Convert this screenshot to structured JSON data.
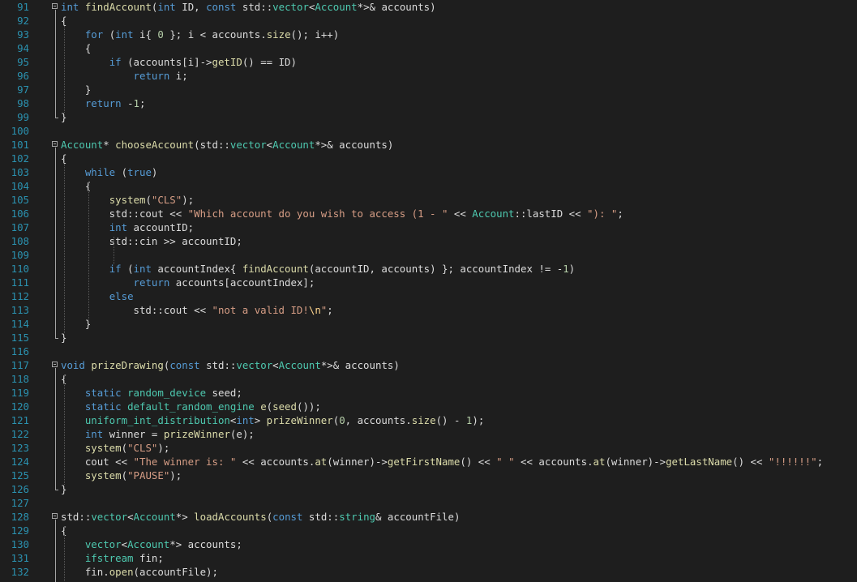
{
  "editor": {
    "colors": {
      "background": "#1e1e1e",
      "line_number": "#2b91af",
      "keyword": "#569cd6",
      "type": "#4ec9b0",
      "function": "#dcdcaa",
      "string": "#d69d85",
      "number": "#b5cea8",
      "plain": "#dcdcdc"
    },
    "lines": [
      {
        "n": "91",
        "fold": true,
        "tokens": [
          {
            "t": "int",
            "c": "kw"
          },
          {
            "t": " "
          },
          {
            "t": "findAccount",
            "c": "fn"
          },
          {
            "t": "("
          },
          {
            "t": "int",
            "c": "kw"
          },
          {
            "t": " ID, "
          },
          {
            "t": "const",
            "c": "kw"
          },
          {
            "t": " std::"
          },
          {
            "t": "vector",
            "c": "ty"
          },
          {
            "t": "<"
          },
          {
            "t": "Account",
            "c": "ty"
          },
          {
            "t": "*>& accounts)"
          }
        ]
      },
      {
        "n": "92",
        "tokens": [
          {
            "t": "{"
          }
        ]
      },
      {
        "n": "93",
        "tokens": [
          {
            "t": "    "
          },
          {
            "t": "for",
            "c": "kw"
          },
          {
            "t": " ("
          },
          {
            "t": "int",
            "c": "kw"
          },
          {
            "t": " i{ "
          },
          {
            "t": "0",
            "c": "num"
          },
          {
            "t": " }; i < accounts."
          },
          {
            "t": "size",
            "c": "fn"
          },
          {
            "t": "(); i++)"
          }
        ]
      },
      {
        "n": "94",
        "tokens": [
          {
            "t": "    {"
          }
        ]
      },
      {
        "n": "95",
        "tokens": [
          {
            "t": "        "
          },
          {
            "t": "if",
            "c": "kw"
          },
          {
            "t": " (accounts[i]->"
          },
          {
            "t": "getID",
            "c": "fn"
          },
          {
            "t": "() == ID)"
          }
        ]
      },
      {
        "n": "96",
        "tokens": [
          {
            "t": "            "
          },
          {
            "t": "return",
            "c": "kw"
          },
          {
            "t": " i;"
          }
        ]
      },
      {
        "n": "97",
        "tokens": [
          {
            "t": "    }"
          }
        ]
      },
      {
        "n": "98",
        "tokens": [
          {
            "t": "    "
          },
          {
            "t": "return",
            "c": "kw"
          },
          {
            "t": " -"
          },
          {
            "t": "1",
            "c": "num"
          },
          {
            "t": ";"
          }
        ]
      },
      {
        "n": "99",
        "tokens": [
          {
            "t": "}"
          }
        ]
      },
      {
        "n": "100",
        "tokens": []
      },
      {
        "n": "101",
        "fold": true,
        "tokens": [
          {
            "t": "Account",
            "c": "ty"
          },
          {
            "t": "* "
          },
          {
            "t": "chooseAccount",
            "c": "fn"
          },
          {
            "t": "(std::"
          },
          {
            "t": "vector",
            "c": "ty"
          },
          {
            "t": "<"
          },
          {
            "t": "Account",
            "c": "ty"
          },
          {
            "t": "*>& accounts)"
          }
        ]
      },
      {
        "n": "102",
        "tokens": [
          {
            "t": "{"
          }
        ]
      },
      {
        "n": "103",
        "tokens": [
          {
            "t": "    "
          },
          {
            "t": "while",
            "c": "kw"
          },
          {
            "t": " ("
          },
          {
            "t": "true",
            "c": "kw"
          },
          {
            "t": ")"
          }
        ]
      },
      {
        "n": "104",
        "tokens": [
          {
            "t": "    {"
          }
        ]
      },
      {
        "n": "105",
        "tokens": [
          {
            "t": "        "
          },
          {
            "t": "system",
            "c": "fn"
          },
          {
            "t": "("
          },
          {
            "t": "\"CLS\"",
            "c": "str"
          },
          {
            "t": ");"
          }
        ]
      },
      {
        "n": "106",
        "tokens": [
          {
            "t": "        std::cout << "
          },
          {
            "t": "\"Which account do you wish to access (1 - \"",
            "c": "str"
          },
          {
            "t": " << "
          },
          {
            "t": "Account",
            "c": "ty"
          },
          {
            "t": "::lastID << "
          },
          {
            "t": "\"): \"",
            "c": "str"
          },
          {
            "t": ";"
          }
        ]
      },
      {
        "n": "107",
        "tokens": [
          {
            "t": "        "
          },
          {
            "t": "int",
            "c": "kw"
          },
          {
            "t": " accountID;"
          }
        ]
      },
      {
        "n": "108",
        "tokens": [
          {
            "t": "        std::cin >> accountID;"
          }
        ]
      },
      {
        "n": "109",
        "tokens": []
      },
      {
        "n": "110",
        "tokens": [
          {
            "t": "        "
          },
          {
            "t": "if",
            "c": "kw"
          },
          {
            "t": " ("
          },
          {
            "t": "int",
            "c": "kw"
          },
          {
            "t": " accountIndex{ "
          },
          {
            "t": "findAccount",
            "c": "fn"
          },
          {
            "t": "(accountID, accounts) }; accountIndex != -"
          },
          {
            "t": "1",
            "c": "num"
          },
          {
            "t": ")"
          }
        ]
      },
      {
        "n": "111",
        "tokens": [
          {
            "t": "            "
          },
          {
            "t": "return",
            "c": "kw"
          },
          {
            "t": " accounts[accountIndex];"
          }
        ]
      },
      {
        "n": "112",
        "tokens": [
          {
            "t": "        "
          },
          {
            "t": "else",
            "c": "kw"
          }
        ]
      },
      {
        "n": "113",
        "tokens": [
          {
            "t": "            std::cout << "
          },
          {
            "t": "\"not a valid ID!",
            "c": "str"
          },
          {
            "t": "\\n",
            "c": "esc"
          },
          {
            "t": "\"",
            "c": "str"
          },
          {
            "t": ";"
          }
        ]
      },
      {
        "n": "114",
        "tokens": [
          {
            "t": "    }"
          }
        ]
      },
      {
        "n": "115",
        "tokens": [
          {
            "t": "}"
          }
        ]
      },
      {
        "n": "116",
        "tokens": []
      },
      {
        "n": "117",
        "fold": true,
        "tokens": [
          {
            "t": "void",
            "c": "kw"
          },
          {
            "t": " "
          },
          {
            "t": "prizeDrawing",
            "c": "fn"
          },
          {
            "t": "("
          },
          {
            "t": "const",
            "c": "kw"
          },
          {
            "t": " std::"
          },
          {
            "t": "vector",
            "c": "ty"
          },
          {
            "t": "<"
          },
          {
            "t": "Account",
            "c": "ty"
          },
          {
            "t": "*>& accounts)"
          }
        ]
      },
      {
        "n": "118",
        "tokens": [
          {
            "t": "{"
          }
        ]
      },
      {
        "n": "119",
        "tokens": [
          {
            "t": "    "
          },
          {
            "t": "static",
            "c": "kw"
          },
          {
            "t": " "
          },
          {
            "t": "random_device",
            "c": "ty"
          },
          {
            "t": " seed;"
          }
        ]
      },
      {
        "n": "120",
        "tokens": [
          {
            "t": "    "
          },
          {
            "t": "static",
            "c": "kw"
          },
          {
            "t": " "
          },
          {
            "t": "default_random_engine",
            "c": "ty"
          },
          {
            "t": " "
          },
          {
            "t": "e",
            "c": "fn"
          },
          {
            "t": "("
          },
          {
            "t": "seed",
            "c": "fn"
          },
          {
            "t": "());"
          }
        ]
      },
      {
        "n": "121",
        "tokens": [
          {
            "t": "    "
          },
          {
            "t": "uniform_int_distribution",
            "c": "ty"
          },
          {
            "t": "<"
          },
          {
            "t": "int",
            "c": "kw"
          },
          {
            "t": "> "
          },
          {
            "t": "prizeWinner",
            "c": "fn"
          },
          {
            "t": "("
          },
          {
            "t": "0",
            "c": "num"
          },
          {
            "t": ", accounts."
          },
          {
            "t": "size",
            "c": "fn"
          },
          {
            "t": "() - "
          },
          {
            "t": "1",
            "c": "num"
          },
          {
            "t": ");"
          }
        ]
      },
      {
        "n": "122",
        "tokens": [
          {
            "t": "    "
          },
          {
            "t": "int",
            "c": "kw"
          },
          {
            "t": " winner = "
          },
          {
            "t": "prizeWinner",
            "c": "fn"
          },
          {
            "t": "(e);"
          }
        ]
      },
      {
        "n": "123",
        "tokens": [
          {
            "t": "    "
          },
          {
            "t": "system",
            "c": "fn"
          },
          {
            "t": "("
          },
          {
            "t": "\"CLS\"",
            "c": "str"
          },
          {
            "t": ");"
          }
        ]
      },
      {
        "n": "124",
        "tokens": [
          {
            "t": "    cout << "
          },
          {
            "t": "\"The winner is: \"",
            "c": "str"
          },
          {
            "t": " << accounts."
          },
          {
            "t": "at",
            "c": "fn"
          },
          {
            "t": "(winner)->"
          },
          {
            "t": "getFirstName",
            "c": "fn"
          },
          {
            "t": "() << "
          },
          {
            "t": "\" \"",
            "c": "str"
          },
          {
            "t": " << accounts."
          },
          {
            "t": "at",
            "c": "fn"
          },
          {
            "t": "(winner)->"
          },
          {
            "t": "getLastName",
            "c": "fn"
          },
          {
            "t": "() << "
          },
          {
            "t": "\"!!!!!!\"",
            "c": "str"
          },
          {
            "t": ";"
          }
        ]
      },
      {
        "n": "125",
        "tokens": [
          {
            "t": "    "
          },
          {
            "t": "system",
            "c": "fn"
          },
          {
            "t": "("
          },
          {
            "t": "\"PAUSE\"",
            "c": "str"
          },
          {
            "t": ");"
          }
        ]
      },
      {
        "n": "126",
        "tokens": [
          {
            "t": "}"
          }
        ]
      },
      {
        "n": "127",
        "tokens": []
      },
      {
        "n": "128",
        "fold": true,
        "tokens": [
          {
            "t": "std::"
          },
          {
            "t": "vector",
            "c": "ty"
          },
          {
            "t": "<"
          },
          {
            "t": "Account",
            "c": "ty"
          },
          {
            "t": "*> "
          },
          {
            "t": "loadAccounts",
            "c": "fn"
          },
          {
            "t": "("
          },
          {
            "t": "const",
            "c": "kw"
          },
          {
            "t": " std::"
          },
          {
            "t": "string",
            "c": "ty"
          },
          {
            "t": "& accountFile)"
          }
        ]
      },
      {
        "n": "129",
        "tokens": [
          {
            "t": "{"
          }
        ]
      },
      {
        "n": "130",
        "tokens": [
          {
            "t": "    "
          },
          {
            "t": "vector",
            "c": "ty"
          },
          {
            "t": "<"
          },
          {
            "t": "Account",
            "c": "ty"
          },
          {
            "t": "*> accounts;"
          }
        ]
      },
      {
        "n": "131",
        "tokens": [
          {
            "t": "    "
          },
          {
            "t": "ifstream",
            "c": "ty"
          },
          {
            "t": " fin;"
          }
        ]
      },
      {
        "n": "132",
        "tokens": [
          {
            "t": "    fin."
          },
          {
            "t": "open",
            "c": "fn"
          },
          {
            "t": "(accountFile);"
          }
        ]
      }
    ]
  }
}
